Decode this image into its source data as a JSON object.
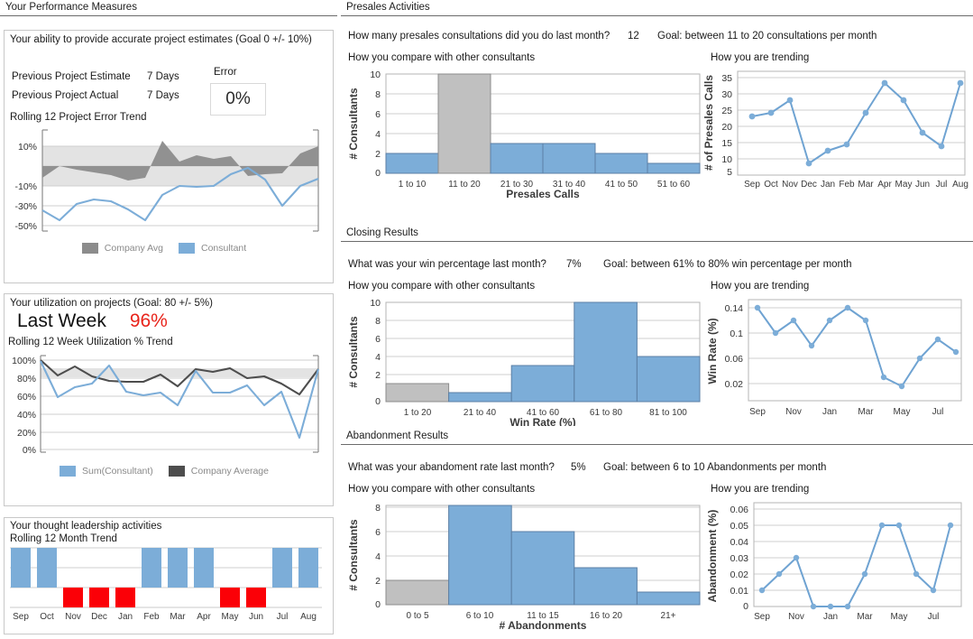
{
  "left": {
    "header": "Your Performance Measures",
    "estimates": {
      "title": "Your ability to provide accurate project estimates (Goal 0 +/- 10%)",
      "error_header": "Error",
      "error_value": "0%",
      "rows": [
        {
          "label": "Previous Project Estimate",
          "value": "7 Days"
        },
        {
          "label": "Previous Project Actual",
          "value": "7 Days"
        }
      ],
      "trend_label": "Rolling 12 Project Error Trend",
      "legend": [
        {
          "label": "Company Avg",
          "color": "#8c8c8c"
        },
        {
          "label": "Consultant",
          "color": "#7cadd8"
        }
      ]
    },
    "utilization": {
      "title": "Your utilization on projects (Goal: 80 +/- 5%)",
      "metric_label": "Last Week",
      "metric_value": "96%",
      "trend_label": "Rolling 12 Week Utilization % Trend",
      "legend": [
        {
          "label": "Sum(Consultant)",
          "color": "#7cadd8"
        },
        {
          "label": "Company Average",
          "color": "#4d4d4d"
        }
      ]
    },
    "thought": {
      "title": "Your thought leadership activities",
      "trend_label": "Rolling 12 Month Trend"
    }
  },
  "right": {
    "presales": {
      "header": "Presales Activities",
      "question": "How many presales consultations did you do last month?",
      "answer": "12",
      "goal": "Goal: between 11 to 20 consultations per month",
      "compare_label": "How you compare with other consultants",
      "trending_label": "How you are trending"
    },
    "closing": {
      "header": "Closing Results",
      "question": "What was your win percentage last month?",
      "answer": "7%",
      "goal": "Goal: between 61% to 80% win percentage per month",
      "compare_label": "How you compare with other consultants",
      "trending_label": "How you are trending"
    },
    "abandonment": {
      "header": "Abandonment Results",
      "question": "What was your abandoment rate last month?",
      "answer": "5%",
      "goal": "Goal: between 6 to 10 Abandonments per month",
      "compare_label": "How you compare with other consultants",
      "trending_label": "How you are trending"
    }
  },
  "colors": {
    "blue": "#7cadd8",
    "blue_stroke": "#5b8fc0",
    "grey_bar": "#bfbfbf",
    "dark_grey": "#4d4d4d",
    "mid_grey": "#8c8c8c",
    "band": "#dedede",
    "red": "#fb0007"
  },
  "chart_data": [
    {
      "type": "area",
      "name": "project-error-trend",
      "title": "Rolling 12 Project Error Trend",
      "xlabel": "",
      "ylabel": "",
      "ytick_labels": [
        "10%",
        "-10%",
        "-30%",
        "-50%"
      ],
      "ytick_values": [
        10,
        -10,
        -30,
        -50
      ],
      "ylim": [
        -58,
        18
      ],
      "grid": true,
      "series": [
        {
          "name": "Consultant",
          "type": "line",
          "color": "#7cadd8",
          "values": [
            -35,
            -45,
            -27,
            -23,
            -24,
            -33,
            -45,
            -17,
            -9,
            -10,
            -9,
            3,
            9,
            -3,
            -30,
            -9,
            -3
          ]
        },
        {
          "name": "Company Avg",
          "type": "band",
          "color": "#8c8c8c",
          "values": [
            -12,
            0,
            -3,
            -6,
            -8,
            -12,
            -10,
            13,
            2,
            5,
            3,
            5,
            -7,
            -6,
            -5,
            6,
            10
          ]
        }
      ]
    },
    {
      "type": "line",
      "name": "utilization-trend",
      "title": "Rolling 12 Week Utilization % Trend",
      "ytick_labels": [
        "100%",
        "80%",
        "60%",
        "40%",
        "20%",
        "0%"
      ],
      "ytick_values": [
        100,
        80,
        60,
        40,
        20,
        0
      ],
      "ylim": [
        0,
        104
      ],
      "goal_band": [
        75,
        85
      ],
      "grid": true,
      "series": [
        {
          "name": "Sum(Consultant)",
          "color": "#7cadd8",
          "values": [
            99,
            61,
            72,
            76,
            94,
            65,
            61,
            64,
            50,
            88,
            64,
            64,
            72,
            50,
            65,
            14,
            88
          ]
        },
        {
          "name": "Company Average",
          "color": "#4d4d4d",
          "values": [
            100,
            83,
            93,
            82,
            77,
            76,
            76,
            84,
            71,
            88,
            86,
            90,
            79,
            82,
            74,
            62,
            88
          ]
        }
      ]
    },
    {
      "type": "bar",
      "name": "thought-leadership-trend",
      "title": "Rolling 12 Month Trend",
      "categories": [
        "Sep",
        "Oct",
        "Nov",
        "Dec",
        "Jan",
        "Feb",
        "Mar",
        "Apr",
        "May",
        "Jun",
        "Jul",
        "Aug"
      ],
      "values": [
        1,
        1,
        -1,
        -1,
        -1,
        1,
        1,
        1,
        -1,
        -1,
        1,
        1
      ],
      "positive_color": "#7cadd8",
      "negative_color": "#fb0007"
    },
    {
      "type": "bar",
      "name": "presales-histogram",
      "title": "How you compare with other consultants",
      "xlabel": "Presales Calls",
      "ylabel": "# Consultants",
      "categories": [
        "1 to 10",
        "11 to 20",
        "21 to 30",
        "31 to 40",
        "41 to 50",
        "51 to 60"
      ],
      "values": [
        2,
        10,
        3,
        3,
        2,
        1
      ],
      "highlight_index": 1,
      "ylim": [
        0,
        10
      ],
      "ytick_values": [
        0,
        2,
        4,
        6,
        8,
        10
      ]
    },
    {
      "type": "line",
      "name": "presales-trend",
      "title": "How you are trending",
      "ylabel": "# of Presales Calls",
      "categories": [
        "Sep",
        "Oct",
        "Nov",
        "Dec",
        "Jan",
        "Feb",
        "Mar",
        "Apr",
        "May",
        "Jun",
        "Jul",
        "Aug"
      ],
      "values": [
        23,
        24,
        28,
        9,
        13,
        15,
        24,
        33,
        28,
        18,
        14,
        33
      ],
      "ylim": [
        5,
        36
      ],
      "ytick_values": [
        5,
        10,
        15,
        20,
        25,
        30,
        35
      ]
    },
    {
      "type": "bar",
      "name": "winrate-histogram",
      "title": "How you compare with other consultants",
      "xlabel": "Win Rate (%)",
      "ylabel": "# Consultants",
      "categories": [
        "1 to 20",
        "21 to 40",
        "41 to 60",
        "61 to 80",
        "81 to 100"
      ],
      "values": [
        2,
        1,
        3,
        11,
        4
      ],
      "highlight_index": 0,
      "ylim": [
        0,
        10.8
      ],
      "ytick_values": [
        0,
        2,
        4,
        6,
        8,
        10
      ]
    },
    {
      "type": "line",
      "name": "winrate-trend",
      "title": "How you are trending",
      "ylabel": "Win Rate (%)",
      "categories": [
        "Sep",
        "Oct",
        "Nov",
        "Dec",
        "Jan",
        "Feb",
        "Mar",
        "Apr",
        "May",
        "Jun",
        "Jul",
        "Aug"
      ],
      "tick_labels": [
        "Sep",
        "Nov",
        "Jan",
        "Mar",
        "May",
        "Jul"
      ],
      "values": [
        0.14,
        0.1,
        0.12,
        0.08,
        0.12,
        0.14,
        0.12,
        0.04,
        0.025,
        0.06,
        0.09,
        0.072
      ],
      "ylim": [
        0.012,
        0.152
      ],
      "ytick_values": [
        0.02,
        0.06,
        0.1,
        0.14
      ],
      "ytick_labels": [
        "0.02",
        "0.06",
        "0.1",
        "0.14"
      ]
    },
    {
      "type": "bar",
      "name": "abandonment-histogram",
      "title": "How you compare with other consultants",
      "xlabel": "# Abandonments",
      "ylabel": "# Consultants",
      "categories": [
        "0 to 5",
        "6 to 10",
        "11 to 15",
        "16 to 20",
        "21+"
      ],
      "values": [
        2,
        8.5,
        6,
        3,
        1
      ],
      "highlight_index": 0,
      "ylim": [
        0,
        8.6
      ],
      "ytick_values": [
        0,
        2,
        4,
        6,
        8
      ]
    },
    {
      "type": "line",
      "name": "abandonment-trend",
      "title": "How you are trending",
      "ylabel": "Abandonment (%)",
      "categories": [
        "Sep",
        "Oct",
        "Nov",
        "Dec",
        "Jan",
        "Feb",
        "Mar",
        "Apr",
        "May",
        "Jun",
        "Jul",
        "Aug"
      ],
      "tick_labels": [
        "Sep",
        "Nov",
        "Jan",
        "Mar",
        "May",
        "Jul"
      ],
      "values": [
        0.01,
        0.02,
        0.03,
        0.0,
        0.0,
        0.0,
        0.02,
        0.05,
        0.05,
        0.02,
        0.01,
        0.05
      ],
      "ylim": [
        0,
        0.062
      ],
      "ytick_values": [
        0,
        0.01,
        0.02,
        0.03,
        0.04,
        0.05,
        0.06
      ],
      "ytick_labels": [
        "0",
        "0.01",
        "0.02",
        "0.03",
        "0.04",
        "0.05",
        "0.06"
      ]
    }
  ]
}
